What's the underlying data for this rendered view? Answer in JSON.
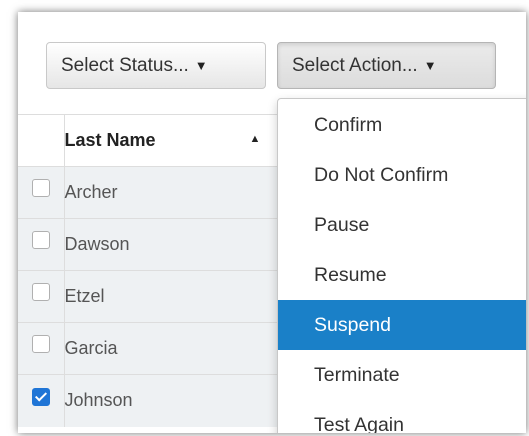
{
  "toolbar": {
    "status_label": "Select Status...",
    "action_label": "Select Action...",
    "caret": "▼"
  },
  "table": {
    "header": {
      "last_name": "Last Name",
      "sort_glyph": "▲"
    },
    "rows": [
      {
        "last_name": "Archer",
        "checked": false
      },
      {
        "last_name": "Dawson",
        "checked": false
      },
      {
        "last_name": "Etzel",
        "checked": false
      },
      {
        "last_name": "Garcia",
        "checked": false
      },
      {
        "last_name": "Johnson",
        "checked": true
      }
    ]
  },
  "action_menu": {
    "items": [
      "Confirm",
      "Do Not Confirm",
      "Pause",
      "Resume",
      "Suspend",
      "Terminate",
      "Test Again"
    ],
    "highlighted": "Suspend"
  },
  "colors": {
    "highlight": "#1a80c8",
    "checkbox_checked": "#1f75d6",
    "row_background": "#eef1f3"
  }
}
